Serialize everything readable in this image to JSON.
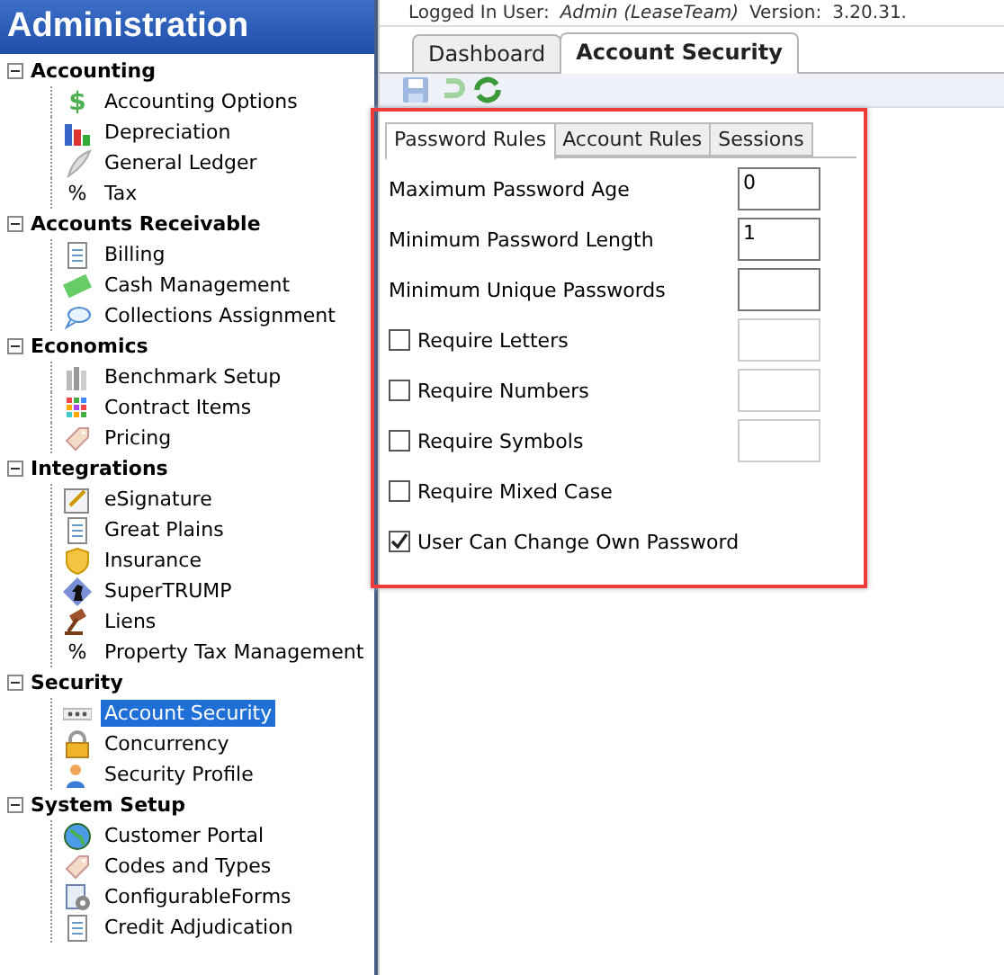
{
  "sidebar": {
    "title": "Administration",
    "groups": [
      {
        "label": "Accounting",
        "expanded": true,
        "children": [
          {
            "label": "Accounting Options",
            "kind": "dollar",
            "glyph": "$",
            "selected": false
          },
          {
            "label": "Depreciation",
            "kind": "bars",
            "selected": false
          },
          {
            "label": "General Ledger",
            "kind": "feather",
            "selected": false
          },
          {
            "label": "Tax",
            "kind": "glyph",
            "glyph": "%",
            "selected": false
          }
        ]
      },
      {
        "label": "Accounts Receivable",
        "expanded": true,
        "children": [
          {
            "label": "Billing",
            "kind": "document",
            "selected": false
          },
          {
            "label": "Cash Management",
            "kind": "cash",
            "selected": false
          },
          {
            "label": "Collections Assignment",
            "kind": "chat",
            "selected": false
          }
        ]
      },
      {
        "label": "Economics",
        "expanded": true,
        "children": [
          {
            "label": "Benchmark Setup",
            "kind": "columns",
            "selected": false
          },
          {
            "label": "Contract Items",
            "kind": "grid",
            "selected": false
          },
          {
            "label": "Pricing",
            "kind": "tag",
            "selected": false
          }
        ]
      },
      {
        "label": "Integrations",
        "expanded": true,
        "children": [
          {
            "label": "eSignature",
            "kind": "sign",
            "selected": false
          },
          {
            "label": "Great Plains",
            "kind": "document",
            "selected": false
          },
          {
            "label": "Insurance",
            "kind": "shield",
            "selected": false
          },
          {
            "label": "SuperTRUMP",
            "kind": "chess",
            "selected": false
          },
          {
            "label": "Liens",
            "kind": "gavel",
            "selected": false
          },
          {
            "label": "Property Tax Management",
            "kind": "glyph",
            "glyph": "%",
            "selected": false
          }
        ]
      },
      {
        "label": "Security",
        "expanded": true,
        "children": [
          {
            "label": "Account Security",
            "kind": "dots",
            "selected": true
          },
          {
            "label": "Concurrency",
            "kind": "lock",
            "selected": false
          },
          {
            "label": "Security Profile",
            "kind": "person",
            "selected": false
          }
        ]
      },
      {
        "label": "System Setup",
        "expanded": true,
        "children": [
          {
            "label": "Customer Portal",
            "kind": "globe",
            "selected": false
          },
          {
            "label": "Codes and Types",
            "kind": "tag",
            "selected": false
          },
          {
            "label": "ConfigurableForms",
            "kind": "gear",
            "selected": false
          },
          {
            "label": "Credit Adjudication",
            "kind": "document",
            "selected": false
          }
        ]
      }
    ]
  },
  "user_bar": {
    "label": "Logged In User:",
    "user": "Admin (LeaseTeam)",
    "version_label": "Version:",
    "version": "3.20.31."
  },
  "tabs": [
    {
      "label": "Dashboard",
      "selected": false
    },
    {
      "label": "Account Security",
      "selected": true
    }
  ],
  "panel": {
    "tabs": [
      {
        "label": "Password Rules",
        "selected": true
      },
      {
        "label": "Account Rules",
        "selected": false
      },
      {
        "label": "Sessions",
        "selected": false
      }
    ],
    "rows": [
      {
        "kind": "field",
        "label": "Maximum Password Age",
        "input": {
          "value": "0",
          "disabled": false
        }
      },
      {
        "kind": "field",
        "label": "Minimum Password Length",
        "input": {
          "value": "1",
          "disabled": false
        }
      },
      {
        "kind": "field",
        "label": "Minimum Unique Passwords",
        "input": {
          "disabled": false
        }
      },
      {
        "kind": "check",
        "label": "Require Letters",
        "checked": false,
        "input": {
          "disabled": true
        }
      },
      {
        "kind": "check",
        "label": "Require Numbers",
        "checked": false,
        "input": {
          "disabled": true
        }
      },
      {
        "kind": "check",
        "label": "Require Symbols",
        "checked": false,
        "input": {
          "disabled": true
        }
      },
      {
        "kind": "check",
        "label": "Require Mixed Case",
        "checked": false
      },
      {
        "kind": "check",
        "label": "User Can Change Own Password",
        "checked": true
      }
    ]
  }
}
